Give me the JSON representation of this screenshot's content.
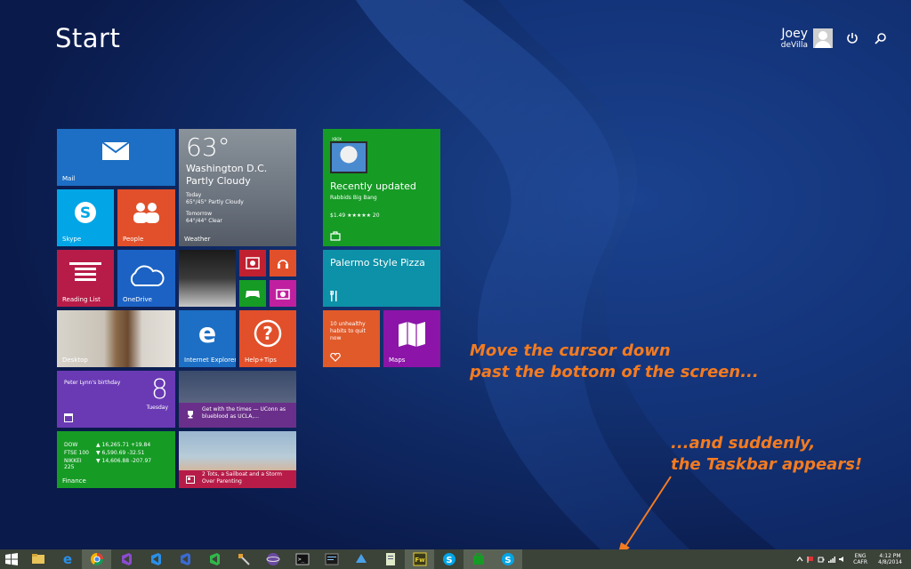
{
  "header": {
    "title": "Start"
  },
  "user": {
    "first_name": "Joey",
    "last_name": "deVilla"
  },
  "tiles": {
    "mail": "Mail",
    "weather": {
      "temp": "63°",
      "city": "Washington D.C.",
      "condition": "Partly Cloudy",
      "today_label": "Today",
      "today_forecast": "65°/45° Partly Cloudy",
      "tomorrow_label": "Tomorrow",
      "tomorrow_forecast": "64°/44° Clear",
      "label": "Weather"
    },
    "skype": "Skype",
    "people": "People",
    "reading_list": "Reading List",
    "onedrive": "OneDrive",
    "desktop": "Desktop",
    "ie": "Internet Explorer",
    "help": "Help+Tips",
    "calendar": {
      "event": "Peter Lynn's birthday",
      "day_number": "8",
      "weekday": "Tuesday"
    },
    "sports_news": "Get with the times — UConn as blueblood as UCLA,...",
    "finance": {
      "label": "Finance",
      "rows": [
        {
          "name": "DOW",
          "value": "▲ 16,265.71 +19.84"
        },
        {
          "name": "FTSE 100",
          "value": "▼ 6,590.69 -32.51"
        },
        {
          "name": "NIKKEI 225",
          "value": "▼ 14,606.88 -207.97"
        }
      ]
    },
    "parenting_news": "2 Tots, a Sailboat and a Storm Over Parenting",
    "store": {
      "badge": "XBOX",
      "label": "Recently updated",
      "game": "Rabbids Big Bang",
      "price": "$1.49 ★★★★★ 20"
    },
    "pizza": "Palermo Style Pizza",
    "health": "10 unhealthy habits to quit now",
    "maps": "Maps"
  },
  "captions": {
    "line1": "Move the cursor down",
    "line2": "past the bottom of the screen...",
    "line3": "...and suddenly,",
    "line4": "the Taskbar appears!"
  },
  "taskbar": {
    "apps": [
      "file-explorer-icon",
      "internet-explorer-icon",
      "chrome-icon",
      "visual-studio-icon",
      "visual-studio-blue-icon",
      "visual-studio-dark-icon",
      "visual-studio-green-icon",
      "tools-icon",
      "sphere-icon",
      "console-icon",
      "terminal-icon",
      "deploy-icon",
      "notepad-icon",
      "fireworks-icon",
      "skype-taskbar-icon",
      "store-taskbar-icon",
      "skype-alt-icon"
    ],
    "fireworks_label": "Fw",
    "lang_top": "ENG",
    "lang_bottom": "CAFR",
    "time": "4:12 PM",
    "date": "4/8/2014"
  },
  "colors": {
    "background": "#0d2157",
    "caption": "#f47b20",
    "taskbar": "#3b4238"
  }
}
